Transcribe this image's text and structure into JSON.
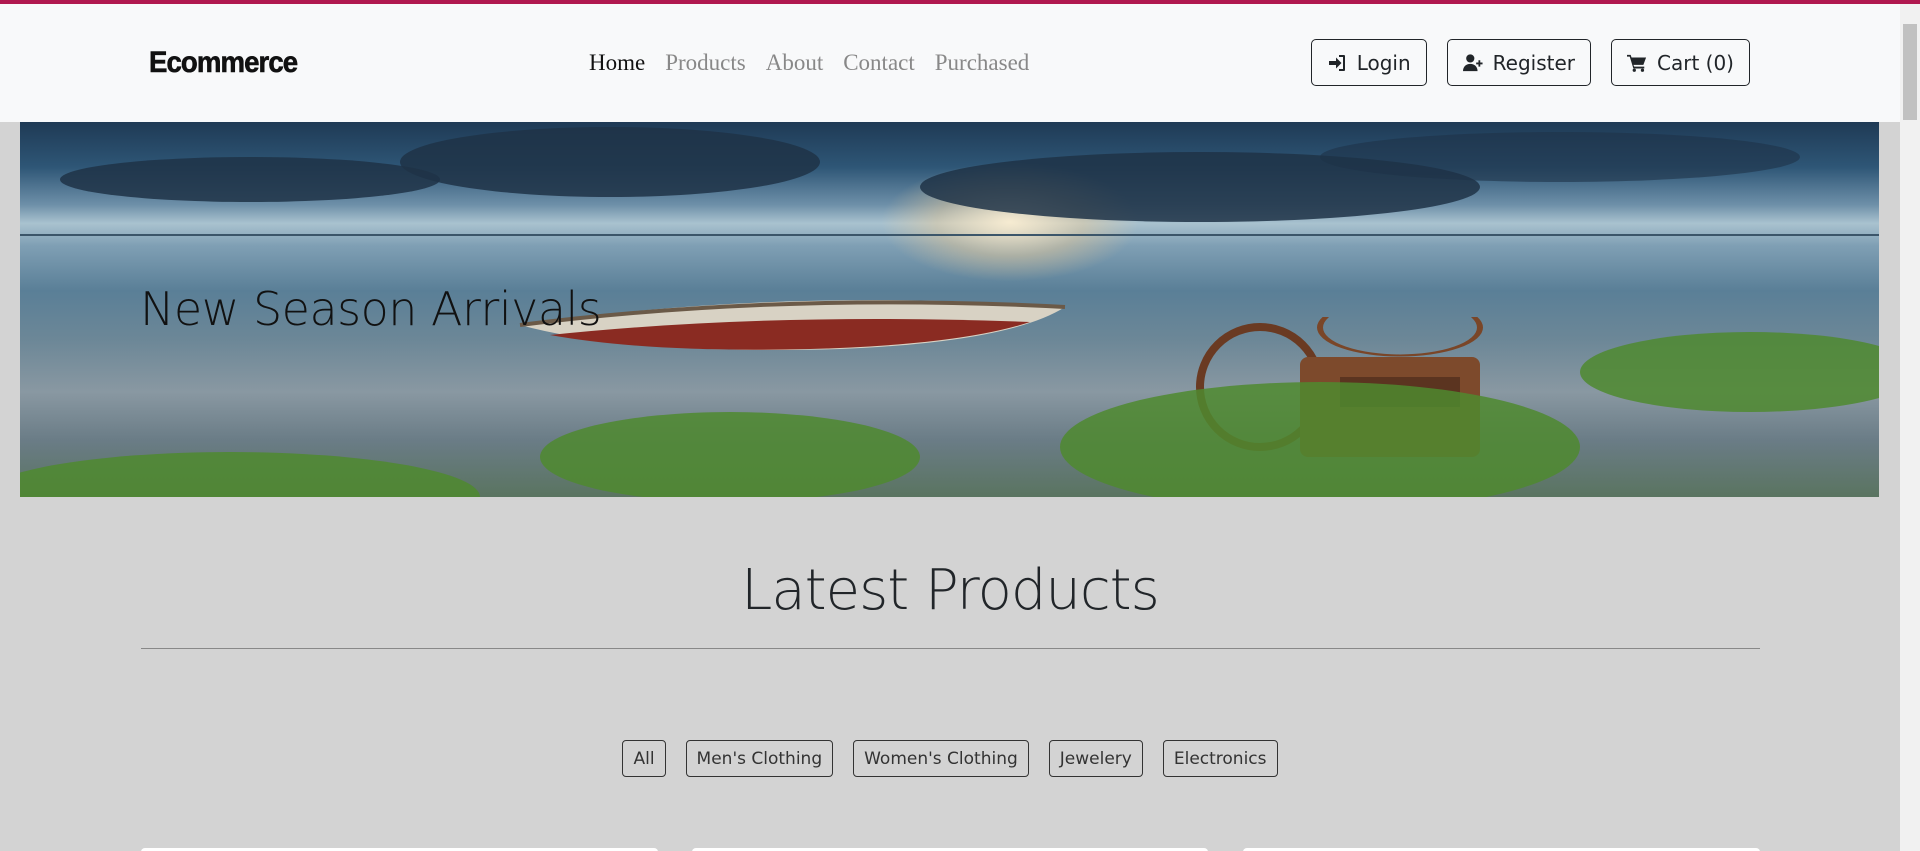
{
  "brand": "Ecommerce",
  "nav": {
    "links": [
      {
        "label": "Home",
        "active": true
      },
      {
        "label": "Products",
        "active": false
      },
      {
        "label": "About",
        "active": false
      },
      {
        "label": "Contact",
        "active": false
      },
      {
        "label": "Purchased",
        "active": false
      }
    ],
    "actions": [
      {
        "label": "Login",
        "icon": "sign-in-icon"
      },
      {
        "label": "Register",
        "icon": "user-plus-icon"
      },
      {
        "label": "Cart (0)",
        "icon": "cart-icon"
      }
    ]
  },
  "hero": {
    "title": "New Season Arrivals"
  },
  "section": {
    "title": "Latest Products"
  },
  "filters": [
    "All",
    "Men's Clothing",
    "Women's Clothing",
    "Jewelery",
    "Electronics"
  ],
  "colors": {
    "accent": "#b0184f",
    "navbar": "#f8f9fa",
    "page_bg": "#d3d3d3"
  }
}
